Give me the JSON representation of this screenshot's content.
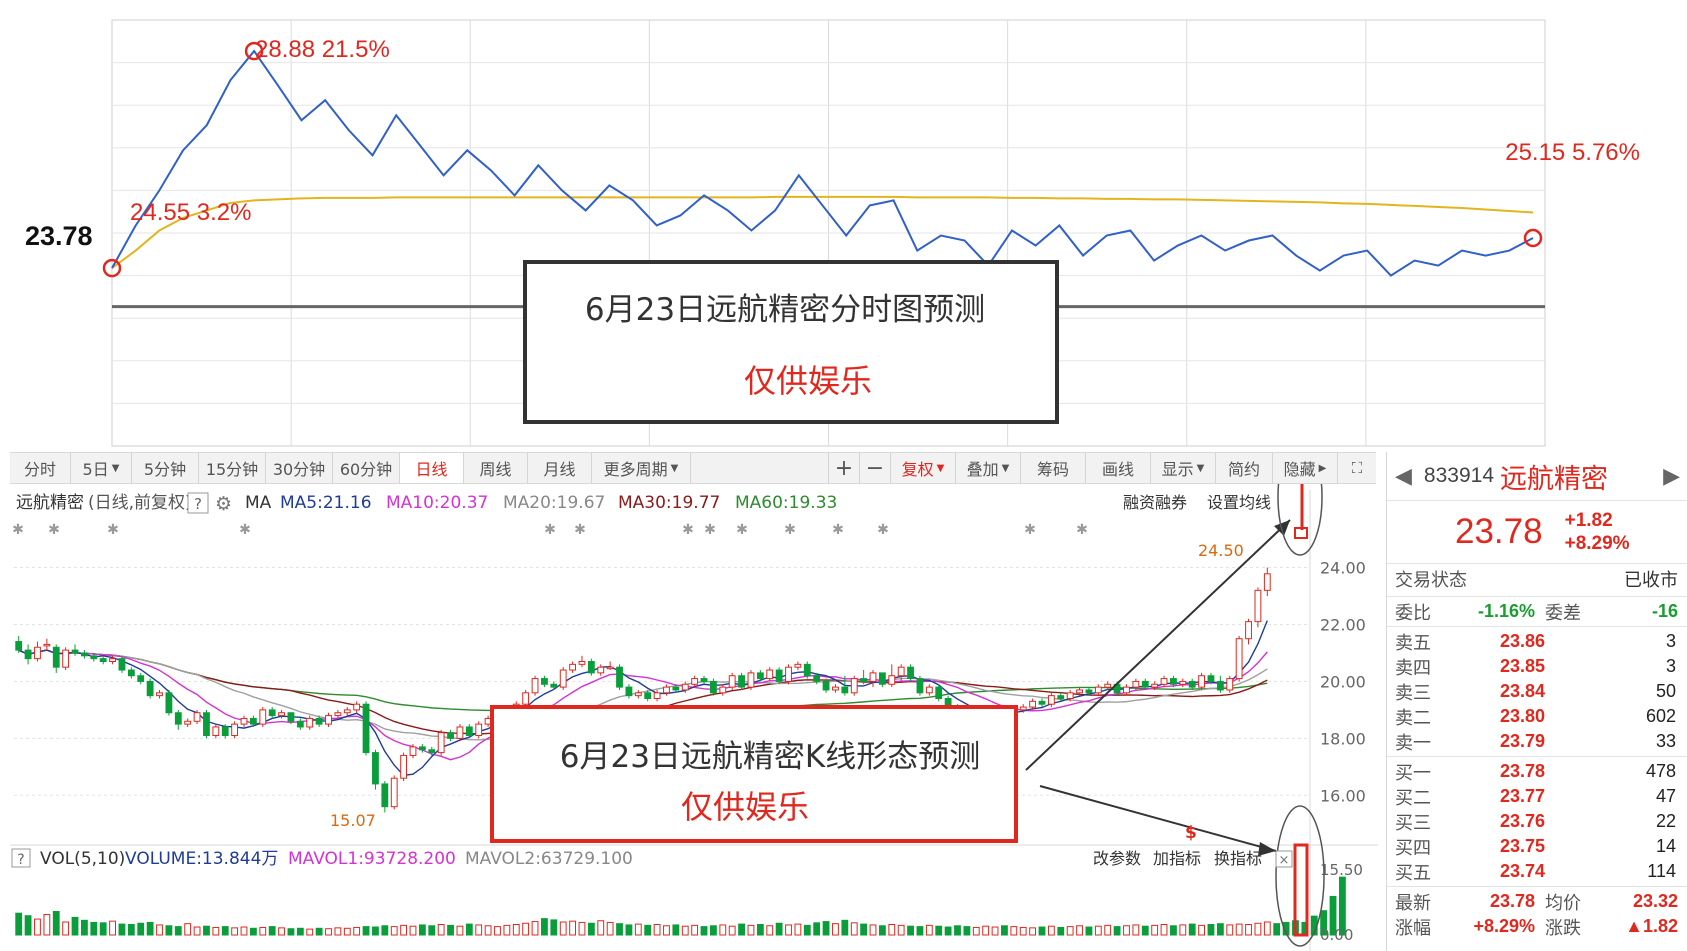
{
  "intraday": {
    "prev_close": "23.78",
    "high_label": "28.88 21.5%",
    "open_label": "24.55 3.2%",
    "close_label": "25.15 5.76%",
    "box_title": "6月23日远航精密分时图预测",
    "box_note": "仅供娱乐",
    "colors": {
      "price": "#3060c8",
      "avg": "#e3b51c",
      "mark": "#e0281e"
    }
  },
  "toolbar": {
    "tabs": [
      "分时",
      "5日",
      "5分钟",
      "15分钟",
      "30分钟",
      "60分钟",
      "日线",
      "周线",
      "月线",
      "更多周期"
    ],
    "active_tab": "日线",
    "tools": [
      "+",
      "−",
      "复权",
      "叠加",
      "筹码",
      "画线",
      "显示",
      "简约",
      "隐藏"
    ]
  },
  "kline": {
    "title": "远航精密",
    "mode": "(日线,前复权)",
    "help": "?",
    "ma_prefix": "MA",
    "ma5": "MA5:21.16",
    "ma10": "MA10:20.37",
    "ma20": "MA20:19.67",
    "ma30": "MA30:19.77",
    "ma60": "MA60:19.33",
    "btn_margin": "融资融券",
    "btn_ma_setting": "设置均线",
    "high_label": "24.50",
    "low_label": "15.07",
    "y_ticks": [
      "24.00",
      "22.00",
      "20.00",
      "18.00",
      "16.00"
    ],
    "box_title": "6月23日远航精密K线形态预测",
    "box_note": "仅供娱乐",
    "vol": {
      "help": "?",
      "name": "VOL(5,10)",
      "volume": "VOLUME:13.844万",
      "mavol1": "MAVOL1:93728.200",
      "mavol2": "MAVOL2:63729.100",
      "btn_params": "改参数",
      "btn_add": "加指标",
      "btn_switch": "换指标",
      "y_ticks": [
        "15.50",
        "0.00"
      ]
    },
    "colors": {
      "up": "#e0281e",
      "down": "#0a9e3a",
      "ma5": "#1f3c9a",
      "ma10": "#d433d4",
      "ma20": "#a0a0a0",
      "ma30": "#8b1a1a",
      "ma60": "#2e8b2e"
    }
  },
  "quote": {
    "code": "833914",
    "name": "远航精密",
    "price": "23.78",
    "change": "+1.82",
    "change_pct": "+8.29%",
    "status_label": "交易状态",
    "status_value": "已收市",
    "wb_label": "委比",
    "wb_value": "-1.16%",
    "wc_label": "委差",
    "wc_value": "-16",
    "asks": [
      {
        "label": "卖五",
        "price": "23.86",
        "vol": "3"
      },
      {
        "label": "卖四",
        "price": "23.85",
        "vol": "3"
      },
      {
        "label": "卖三",
        "price": "23.84",
        "vol": "50"
      },
      {
        "label": "卖二",
        "price": "23.80",
        "vol": "602"
      },
      {
        "label": "卖一",
        "price": "23.79",
        "vol": "33"
      }
    ],
    "bids": [
      {
        "label": "买一",
        "price": "23.78",
        "vol": "478"
      },
      {
        "label": "买二",
        "price": "23.77",
        "vol": "47"
      },
      {
        "label": "买三",
        "price": "23.76",
        "vol": "22"
      },
      {
        "label": "买四",
        "price": "23.75",
        "vol": "14"
      },
      {
        "label": "买五",
        "price": "23.74",
        "vol": "114"
      }
    ],
    "latest_label": "最新",
    "latest_value": "23.78",
    "avg_label": "均价",
    "avg_value": "23.32",
    "pct_label": "涨幅",
    "pct_value": "+8.29%",
    "chg_label": "涨跌",
    "chg_value": "▲1.82"
  },
  "chart_data": [
    {
      "type": "line",
      "series": [
        {
          "values": [
            24.55,
            25.4,
            26.1,
            26.9,
            27.4,
            28.3,
            28.88,
            28.2,
            27.5,
            27.9,
            27.3,
            26.8,
            27.6,
            27.0,
            26.4,
            26.9,
            26.5,
            26.0,
            26.6,
            26.1,
            25.7,
            26.2,
            25.9,
            25.4,
            25.6,
            26.0,
            25.7,
            25.3,
            25.7,
            26.4,
            25.8,
            25.2,
            25.8,
            25.9,
            24.9,
            25.2,
            25.1,
            24.6,
            25.3,
            25.0,
            25.4,
            24.8,
            25.2,
            25.3,
            24.7,
            25.0,
            25.2,
            24.9,
            25.1,
            25.2,
            24.8,
            24.5,
            24.8,
            24.9,
            24.4,
            24.7,
            24.6,
            24.9,
            24.8,
            24.9,
            25.15
          ]
        },
        {
          "values": [
            24.55,
            24.9,
            25.3,
            25.55,
            25.7,
            25.85,
            25.9,
            25.92,
            25.94,
            25.95,
            25.95,
            25.95,
            25.96,
            25.96,
            25.96,
            25.96,
            25.96,
            25.96,
            25.96,
            25.96,
            25.96,
            25.96,
            25.96,
            25.96,
            25.96,
            25.96,
            25.96,
            25.96,
            25.97,
            25.97,
            25.97,
            25.97,
            25.97,
            25.97,
            25.96,
            25.96,
            25.96,
            25.96,
            25.95,
            25.95,
            25.94,
            25.94,
            25.93,
            25.93,
            25.92,
            25.92,
            25.91,
            25.9,
            25.89,
            25.88,
            25.87,
            25.86,
            25.84,
            25.83,
            25.81,
            25.79,
            25.77,
            25.75,
            25.72,
            25.69,
            25.66
          ]
        }
      ],
      "title": "6月23日远航精密分时图预测",
      "ylim": [
        21.0,
        29.5
      ]
    },
    {
      "type": "candlestick",
      "categories": [
        "d1",
        "d2",
        "d3",
        "d4",
        "d5",
        "d6",
        "d7",
        "d8",
        "d9",
        "d10",
        "d11",
        "d12",
        "d13",
        "d14",
        "d15",
        "d16",
        "d17",
        "d18",
        "d19",
        "d20",
        "d21",
        "d22",
        "d23",
        "d24",
        "d25",
        "d26",
        "d27",
        "d28",
        "d29",
        "d30",
        "d31",
        "d32",
        "d33",
        "d34",
        "d35",
        "d36",
        "d37",
        "d38",
        "d39",
        "d40",
        "d41",
        "d42",
        "d43",
        "d44",
        "d45",
        "d46",
        "d47",
        "d48",
        "d49",
        "d50",
        "d51",
        "d52",
        "d53",
        "d54",
        "d55",
        "d56",
        "d57",
        "d58",
        "d59",
        "d60",
        "d61",
        "d62",
        "d63",
        "d64",
        "d65",
        "d66",
        "d67",
        "d68",
        "d69",
        "d70",
        "d71",
        "d72",
        "d73",
        "d74",
        "d75",
        "d76",
        "d77",
        "d78",
        "d79",
        "d80",
        "d81",
        "d82",
        "d83",
        "d84",
        "d85",
        "d86",
        "d87",
        "d88",
        "d89",
        "d90",
        "d91",
        "d92",
        "d93",
        "d94",
        "d95",
        "d96",
        "d97",
        "d98",
        "d99",
        "d100",
        "d101",
        "d102",
        "d103",
        "d104",
        "d105",
        "d106",
        "d107",
        "d108",
        "d109",
        "d110",
        "d111",
        "d112",
        "d113",
        "d114",
        "d115",
        "d116",
        "d117",
        "d118",
        "d119",
        "d120",
        "d121",
        "d122",
        "d123",
        "d124",
        "d125",
        "d126",
        "d127",
        "d128",
        "d129",
        "d130",
        "d131",
        "d132",
        "d133",
        "d134",
        "d135",
        "d136",
        "d137",
        "d138",
        "d139",
        "d140",
        "d141",
        "d142"
      ],
      "open": [
        21.4,
        21.1,
        20.8,
        21.3,
        21.2,
        20.5,
        21.1,
        21.0,
        20.9,
        20.8,
        20.7,
        20.8,
        20.4,
        20.2,
        20.0,
        19.5,
        19.6,
        18.9,
        18.5,
        18.6,
        18.9,
        18.1,
        18.4,
        18.1,
        18.5,
        18.7,
        18.5,
        19.0,
        18.8,
        18.9,
        18.6,
        18.4,
        18.7,
        18.5,
        18.8,
        18.9,
        19.0,
        19.2,
        17.5,
        16.4,
        15.6,
        16.6,
        17.4,
        17.7,
        17.6,
        17.5,
        18.2,
        18.0,
        18.4,
        18.1,
        18.5,
        18.7,
        18.9,
        19.0,
        19.2,
        19.6,
        20.1,
        19.9,
        19.8,
        20.4,
        20.6,
        20.7,
        20.3,
        20.5,
        20.5,
        19.8,
        19.5,
        19.6,
        19.4,
        19.6,
        19.8,
        19.7,
        19.9,
        20.1,
        20.0,
        19.6,
        19.8,
        20.2,
        19.8,
        20.3,
        20.1,
        20.4,
        20.0,
        20.5,
        20.6,
        20.2,
        20.0,
        19.7,
        19.8,
        19.6,
        20.1,
        20.0,
        20.3,
        19.9,
        20.2,
        20.5,
        20.1,
        19.6,
        19.8,
        19.4,
        19.1,
        19.0,
        18.7,
        18.8,
        18.9,
        19.0,
        18.8,
        19.0,
        19.1,
        19.3,
        19.2,
        19.5,
        19.4,
        19.6,
        19.7,
        19.6,
        19.8,
        19.9,
        19.6,
        19.8,
        20.0,
        19.8,
        19.9,
        20.1,
        19.9,
        20.0,
        19.8,
        20.2,
        20.0,
        19.7,
        20.1,
        21.5,
        22.1,
        23.2
      ],
      "close": [
        21.1,
        20.8,
        21.2,
        21.3,
        20.5,
        21.1,
        21.0,
        20.9,
        20.8,
        20.7,
        20.8,
        20.4,
        20.2,
        20.0,
        19.5,
        19.6,
        18.9,
        18.5,
        18.6,
        18.9,
        18.1,
        18.4,
        18.1,
        18.5,
        18.7,
        18.5,
        19.0,
        18.8,
        18.9,
        18.6,
        18.4,
        18.7,
        18.5,
        18.8,
        18.9,
        19.0,
        19.2,
        17.5,
        16.4,
        15.6,
        16.6,
        17.4,
        17.7,
        17.6,
        17.5,
        18.2,
        18.0,
        18.4,
        18.1,
        18.5,
        18.7,
        18.9,
        19.0,
        19.2,
        19.6,
        20.1,
        19.9,
        19.8,
        20.4,
        20.6,
        20.7,
        20.3,
        20.5,
        20.5,
        19.8,
        19.5,
        19.6,
        19.4,
        19.6,
        19.8,
        19.7,
        19.9,
        20.1,
        20.0,
        19.6,
        19.8,
        20.2,
        19.8,
        20.3,
        20.1,
        20.4,
        20.0,
        20.5,
        20.6,
        20.2,
        20.0,
        19.7,
        19.8,
        19.6,
        20.1,
        20.0,
        20.3,
        19.9,
        20.2,
        20.5,
        20.1,
        19.6,
        19.8,
        19.4,
        19.1,
        19.0,
        18.7,
        18.8,
        18.9,
        19.0,
        18.8,
        19.0,
        19.1,
        19.3,
        19.2,
        19.5,
        19.4,
        19.6,
        19.7,
        19.6,
        19.8,
        19.9,
        19.6,
        19.8,
        20.0,
        19.8,
        19.9,
        20.1,
        19.9,
        20.0,
        19.8,
        20.2,
        20.0,
        19.7,
        20.1,
        21.5,
        22.1,
        23.2,
        23.78
      ],
      "high": [
        21.6,
        21.3,
        21.4,
        21.5,
        21.3,
        21.2,
        21.3,
        21.1,
        21.0,
        20.9,
        20.9,
        20.9,
        20.5,
        20.3,
        20.1,
        19.7,
        19.7,
        19.0,
        18.7,
        19.0,
        19.0,
        18.5,
        18.5,
        18.6,
        18.8,
        18.8,
        19.1,
        19.1,
        19.0,
        18.9,
        18.7,
        18.8,
        18.8,
        18.9,
        19.0,
        19.1,
        19.3,
        19.3,
        17.6,
        16.5,
        16.7,
        17.5,
        17.8,
        17.8,
        17.7,
        18.3,
        18.3,
        18.5,
        18.5,
        18.6,
        18.8,
        19.0,
        19.1,
        19.3,
        19.7,
        20.2,
        20.2,
        20.0,
        20.5,
        20.7,
        20.9,
        20.8,
        20.6,
        20.7,
        20.6,
        19.9,
        19.7,
        19.7,
        19.7,
        19.9,
        19.9,
        20.0,
        20.2,
        20.2,
        20.1,
        19.9,
        20.3,
        20.3,
        20.4,
        20.4,
        20.5,
        20.5,
        20.6,
        20.7,
        20.7,
        20.3,
        20.1,
        19.9,
        20.2,
        20.2,
        20.4,
        20.4,
        20.3,
        20.6,
        20.6,
        20.6,
        20.2,
        19.9,
        19.9,
        19.5,
        19.2,
        19.1,
        19.0,
        19.0,
        19.1,
        19.1,
        19.1,
        19.2,
        19.4,
        19.4,
        19.6,
        19.6,
        19.7,
        19.8,
        19.8,
        19.9,
        20.0,
        20.0,
        19.9,
        20.1,
        20.1,
        20.0,
        20.2,
        20.2,
        20.1,
        20.1,
        20.3,
        20.3,
        20.2,
        20.2,
        21.6,
        22.2,
        23.3,
        24.0
      ],
      "low": [
        21.0,
        20.6,
        20.7,
        21.1,
        20.3,
        20.4,
        20.9,
        20.8,
        20.7,
        20.6,
        20.6,
        20.3,
        20.1,
        19.9,
        19.4,
        19.4,
        18.8,
        18.3,
        18.4,
        18.5,
        18.0,
        18.0,
        18.0,
        18.0,
        18.4,
        18.4,
        18.4,
        18.7,
        18.7,
        18.5,
        18.3,
        18.3,
        18.4,
        18.4,
        18.7,
        18.8,
        18.9,
        17.4,
        16.2,
        15.4,
        15.5,
        16.5,
        17.3,
        17.5,
        17.4,
        17.4,
        17.9,
        17.9,
        18.0,
        18.0,
        18.4,
        18.6,
        18.8,
        18.9,
        19.1,
        19.5,
        19.8,
        19.7,
        19.7,
        20.3,
        20.5,
        20.2,
        20.2,
        20.4,
        19.7,
        19.4,
        19.4,
        19.3,
        19.3,
        19.5,
        19.6,
        19.6,
        19.8,
        19.9,
        19.5,
        19.5,
        19.7,
        19.7,
        19.7,
        20.0,
        20.0,
        19.9,
        19.9,
        20.4,
        20.1,
        19.9,
        19.6,
        19.6,
        19.5,
        19.5,
        19.9,
        19.8,
        19.8,
        19.8,
        20.0,
        20.0,
        19.5,
        19.5,
        19.3,
        19.0,
        18.9,
        18.6,
        18.6,
        18.7,
        18.8,
        18.7,
        18.7,
        18.9,
        19.0,
        19.1,
        19.1,
        19.3,
        19.3,
        19.5,
        19.5,
        19.5,
        19.7,
        19.5,
        19.5,
        19.7,
        19.7,
        19.7,
        19.8,
        19.8,
        19.8,
        19.7,
        19.7,
        19.9,
        19.6,
        19.6,
        20.0,
        21.3,
        21.9,
        23.0
      ],
      "ylim": [
        14.5,
        25.6
      ],
      "title": "6月23日远航精密K线形态预测"
    },
    {
      "type": "bar",
      "values": [
        5.2,
        4.6,
        3.8,
        4.9,
        5.6,
        3.1,
        4.2,
        3.5,
        3.0,
        2.9,
        3.3,
        2.6,
        2.5,
        2.8,
        3.0,
        2.4,
        2.2,
        2.0,
        2.7,
        1.9,
        2.1,
        1.8,
        2.0,
        1.7,
        1.9,
        1.6,
        1.8,
        2.0,
        1.7,
        1.5,
        1.6,
        1.4,
        1.6,
        1.5,
        1.7,
        1.6,
        1.8,
        2.0,
        1.9,
        2.2,
        2.0,
        2.3,
        2.1,
        2.4,
        2.2,
        2.5,
        2.3,
        2.1,
        2.6,
        2.4,
        2.2,
        2.0,
        2.3,
        2.5,
        2.8,
        3.2,
        3.9,
        3.6,
        3.1,
        3.3,
        3.0,
        2.8,
        3.4,
        3.0,
        2.7,
        2.4,
        2.6,
        2.3,
        2.5,
        2.2,
        2.4,
        2.1,
        2.3,
        2.0,
        2.2,
        2.4,
        2.1,
        2.6,
        2.3,
        2.5,
        2.2,
        2.8,
        2.4,
        2.6,
        2.3,
        2.9,
        3.2,
        2.7,
        3.5,
        2.9,
        2.6,
        2.4,
        2.2,
        2.5,
        2.3,
        2.1,
        2.0,
        2.3,
        2.1,
        1.9,
        2.2,
        2.0,
        1.8,
        2.1,
        1.9,
        2.2,
        2.0,
        1.8,
        1.7,
        1.9,
        2.1,
        1.8,
        2.0,
        2.2,
        1.9,
        2.1,
        2.3,
        2.0,
        2.2,
        2.4,
        2.1,
        2.3,
        2.5,
        2.2,
        2.4,
        2.6,
        2.3,
        2.5,
        2.7,
        2.4,
        2.6,
        2.5,
        2.8,
        3.1,
        2.7,
        3.0,
        3.4,
        3.0,
        4.5,
        5.8,
        9.2,
        13.8
      ],
      "ylim": [
        0,
        15.5
      ]
    }
  ]
}
